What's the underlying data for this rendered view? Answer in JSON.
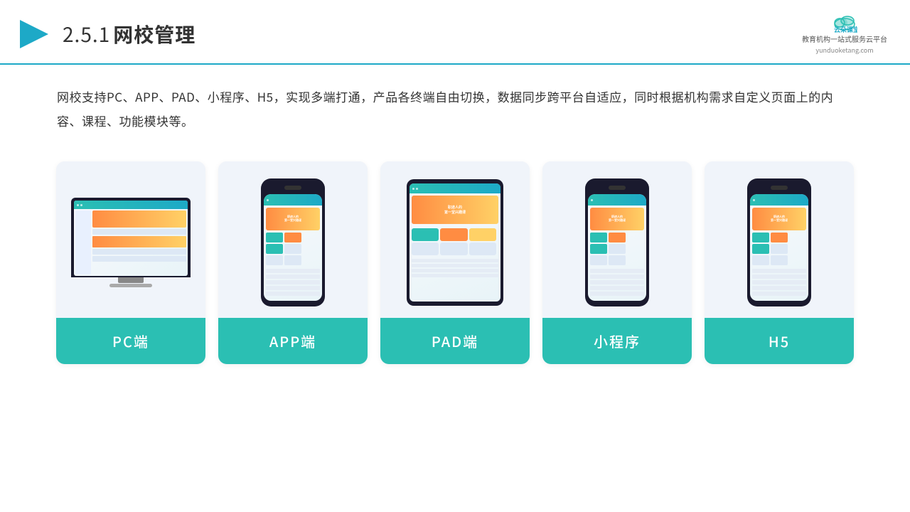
{
  "header": {
    "section_number": "2.5.1",
    "title": "网校管理",
    "logo_main": "云朵课堂",
    "logo_url": "yunduoketang.com",
    "logo_tagline_line1": "教育机构一站",
    "logo_tagline_line2": "式服务云平台"
  },
  "description": {
    "text": "网校支持PC、APP、PAD、小程序、H5，实现多端打通，产品各终端自由切换，数据同步跨平台自适应，同时根据机构需求自定义页面上的内容、课程、功能模块等。"
  },
  "cards": [
    {
      "id": "pc",
      "label": "PC端"
    },
    {
      "id": "app",
      "label": "APP端"
    },
    {
      "id": "pad",
      "label": "PAD端"
    },
    {
      "id": "miniapp",
      "label": "小程序"
    },
    {
      "id": "h5",
      "label": "H5"
    }
  ],
  "colors": {
    "accent": "#2bbfb3",
    "accent_dark": "#1da9c7",
    "header_line": "#1da9c7",
    "card_bg": "#f0f4fa",
    "card_label_bg": "#2bbfb3"
  }
}
